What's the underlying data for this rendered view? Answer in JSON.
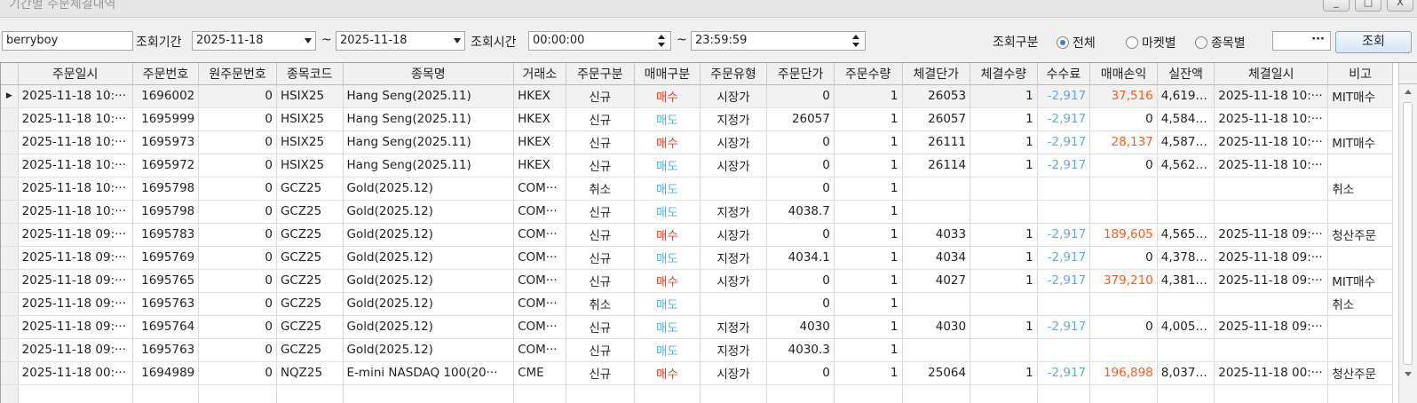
{
  "window": {
    "title": "기간별 주문체결내역",
    "min_label": "_",
    "max_label": "□",
    "close_label": "X"
  },
  "toolbar": {
    "account": "berryboy",
    "period_label": "조회기간",
    "date_from": "2025-11-18",
    "tilde": "~",
    "date_to": "2025-11-18",
    "time_label": "조회시간",
    "time_from": "00:00:00",
    "time_to": "23:59:59",
    "filter_label": "조회구분",
    "radio_all": "전체",
    "radio_market": "마켓별",
    "radio_item": "종목별",
    "selected": "전체",
    "ellipsis": "···",
    "query_label": "조회"
  },
  "grid": {
    "columns": [
      "",
      "주문일시",
      "주문번호",
      "원주문번호",
      "종목코드",
      "종목명",
      "거래소",
      "주문구분",
      "매매구분",
      "주문유형",
      "주문단가",
      "주문수량",
      "체결단가",
      "체결수량",
      "수수료",
      "매매손익",
      "실잔액",
      "체결일시",
      "비고"
    ],
    "selected_row": 0,
    "rows": [
      [
        "2025-11-18 10:···",
        "1696002",
        "0",
        "HSIX25",
        "Hang Seng(2025.11)",
        "HKEX",
        "신규",
        "매수",
        "시장가",
        "0",
        "1",
        "26053",
        "1",
        "-2,917",
        "37,516",
        "4,619,···",
        "2025-11-18 10:···",
        "MIT매수"
      ],
      [
        "2025-11-18 10:···",
        "1695999",
        "0",
        "HSIX25",
        "Hang Seng(2025.11)",
        "HKEX",
        "신규",
        "매도",
        "지정가",
        "26057",
        "1",
        "26057",
        "1",
        "-2,917",
        "0",
        "4,584,···",
        "2025-11-18 10:···",
        ""
      ],
      [
        "2025-11-18 10:···",
        "1695973",
        "0",
        "HSIX25",
        "Hang Seng(2025.11)",
        "HKEX",
        "신규",
        "매수",
        "시장가",
        "0",
        "1",
        "26111",
        "1",
        "-2,917",
        "28,137",
        "4,587,···",
        "2025-11-18 10:···",
        "MIT매수"
      ],
      [
        "2025-11-18 10:···",
        "1695972",
        "0",
        "HSIX25",
        "Hang Seng(2025.11)",
        "HKEX",
        "신규",
        "매도",
        "시장가",
        "0",
        "1",
        "26114",
        "1",
        "-2,917",
        "0",
        "4,562,···",
        "2025-11-18 10:···",
        ""
      ],
      [
        "2025-11-18 10:···",
        "1695798",
        "0",
        "GCZ25",
        "Gold(2025.12)",
        "COM···",
        "취소",
        "매도",
        "",
        "0",
        "1",
        "",
        "",
        "",
        "",
        "",
        "",
        "취소"
      ],
      [
        "2025-11-18 10:···",
        "1695798",
        "0",
        "GCZ25",
        "Gold(2025.12)",
        "COM···",
        "신규",
        "매도",
        "지정가",
        "4038.7",
        "1",
        "",
        "",
        "",
        "",
        "",
        "",
        ""
      ],
      [
        "2025-11-18 09:···",
        "1695783",
        "0",
        "GCZ25",
        "Gold(2025.12)",
        "COM···",
        "신규",
        "매수",
        "시장가",
        "0",
        "1",
        "4033",
        "1",
        "-2,917",
        "189,605",
        "4,565,···",
        "2025-11-18 09:···",
        "청산주문"
      ],
      [
        "2025-11-18 09:···",
        "1695769",
        "0",
        "GCZ25",
        "Gold(2025.12)",
        "COM···",
        "신규",
        "매도",
        "지정가",
        "4034.1",
        "1",
        "4034",
        "1",
        "-2,917",
        "0",
        "4,378,···",
        "2025-11-18 09:···",
        ""
      ],
      [
        "2025-11-18 09:···",
        "1695765",
        "0",
        "GCZ25",
        "Gold(2025.12)",
        "COM···",
        "신규",
        "매수",
        "시장가",
        "0",
        "1",
        "4027",
        "1",
        "-2,917",
        "379,210",
        "4,381,···",
        "2025-11-18 09:···",
        "MIT매수"
      ],
      [
        "2025-11-18 09:···",
        "1695763",
        "0",
        "GCZ25",
        "Gold(2025.12)",
        "COM···",
        "취소",
        "매도",
        "",
        "0",
        "1",
        "",
        "",
        "",
        "",
        "",
        "",
        "취소"
      ],
      [
        "2025-11-18 09:···",
        "1695764",
        "0",
        "GCZ25",
        "Gold(2025.12)",
        "COM···",
        "신규",
        "매도",
        "지정가",
        "4030",
        "1",
        "4030",
        "1",
        "-2,917",
        "0",
        "4,005,···",
        "2025-11-18 09:···",
        ""
      ],
      [
        "2025-11-18 09:···",
        "1695763",
        "0",
        "GCZ25",
        "Gold(2025.12)",
        "COM···",
        "신규",
        "매도",
        "지정가",
        "4030.3",
        "1",
        "",
        "",
        "",
        "",
        "",
        "",
        ""
      ],
      [
        "2025-11-18 00:···",
        "1694989",
        "0",
        "NQZ25",
        "E-mini NASDAQ 100(20···",
        "CME",
        "신규",
        "매수",
        "시장가",
        "0",
        "1",
        "25064",
        "1",
        "-2,917",
        "196,898",
        "8,037,···",
        "2025-11-18 00:···",
        "청산주문"
      ],
      [
        "",
        "",
        "",
        "",
        "",
        "",
        "",
        "",
        "",
        "",
        "",
        "",
        "",
        "",
        "",
        "",
        "",
        ""
      ]
    ]
  },
  "colors": {
    "buy": "#ff3b1f",
    "sell": "#4fb2ef",
    "fee": "#5fa8e8",
    "pnl": "#ff5a1a",
    "accent": "#3b7fd6"
  },
  "icons": {
    "row_pointer": "triangle-right-icon",
    "dropdown": "chevron-down-icon",
    "spin": "spin-up-down-icon",
    "scroll_up": "arrow-up-icon",
    "scroll_down": "arrow-down-icon"
  }
}
